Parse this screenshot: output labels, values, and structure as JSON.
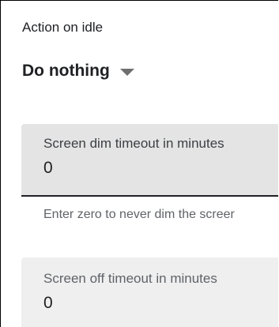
{
  "idle_action": {
    "label": "Action on idle",
    "selected": "Do nothing",
    "caret_icon": "caret-down-icon"
  },
  "screen_dim": {
    "label": "Screen dim timeout in minutes",
    "value": "0",
    "helper": "Enter zero to never dim the screer"
  },
  "screen_off": {
    "label": "Screen off timeout in minutes",
    "value": "0"
  },
  "colors": {
    "field_active_bg": "#e4e4e4",
    "field_inactive_bg": "#efefef",
    "underline": "#202124",
    "caret": "#6f6f6f"
  }
}
